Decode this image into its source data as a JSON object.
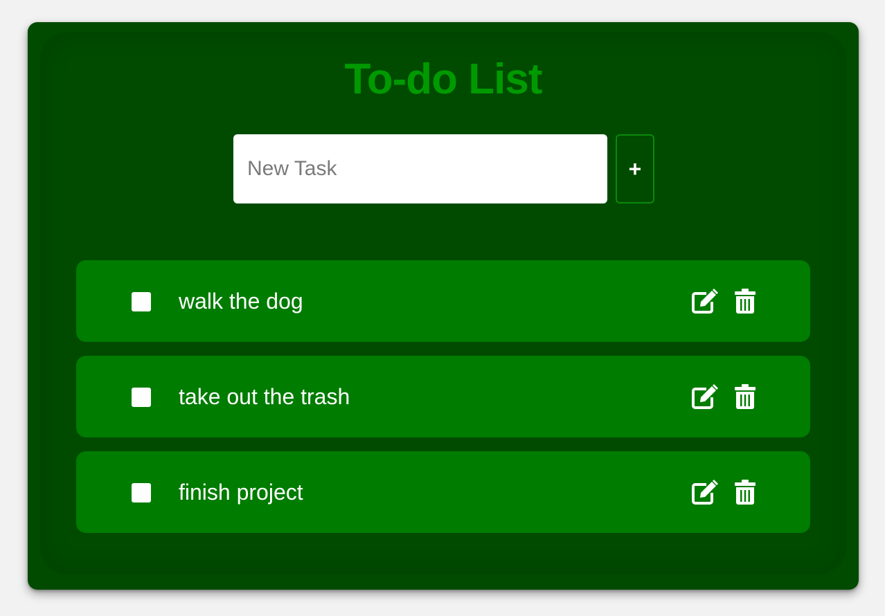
{
  "app": {
    "title": "To-do List"
  },
  "new_task": {
    "placeholder": "New Task",
    "value": "",
    "add_label": "+"
  },
  "tasks": [
    {
      "label": "walk the dog",
      "done": false
    },
    {
      "label": "take out the trash",
      "done": false
    },
    {
      "label": "finish project",
      "done": false
    }
  ],
  "icons": {
    "edit": "edit-icon",
    "delete": "trash-icon"
  },
  "colors": {
    "background": "#f2f2f2",
    "card": "#004b00",
    "title": "#009a00",
    "row": "#007c00",
    "text": "#ffffff"
  }
}
